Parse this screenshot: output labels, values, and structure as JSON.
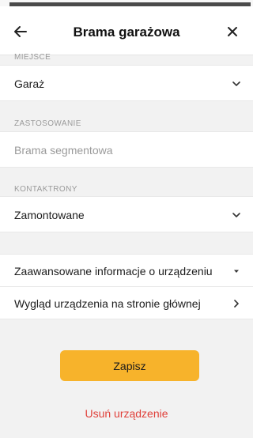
{
  "header": {
    "title": "Brama garażowa",
    "back_icon": "arrow-left-icon",
    "close_icon": "close-icon"
  },
  "fields": {
    "miejsce": {
      "label": "MIEJSCE",
      "value": "Garaż"
    },
    "zastosowanie": {
      "label": "ZASTOSOWANIE",
      "placeholder": "Brama segmentowa"
    },
    "kontaktrony": {
      "label": "KONTAKTRONY",
      "value": "Zamontowane"
    }
  },
  "menu": {
    "advanced": "Zaawansowane informacje o urządzeniu",
    "appearance": "Wygląd urządzenia na stronie głównej"
  },
  "actions": {
    "save": "Zapisz",
    "delete": "Usuń urządzenie"
  },
  "colors": {
    "accent": "#f7b32b",
    "danger": "#e0403a"
  }
}
